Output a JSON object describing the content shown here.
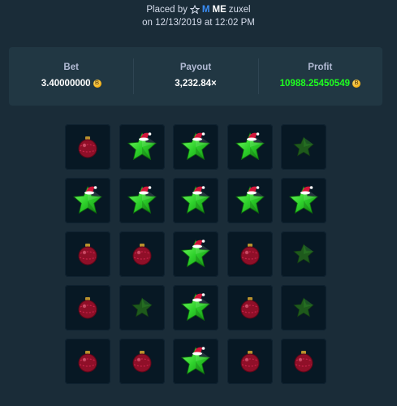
{
  "header": {
    "placed_by_label": "Placed by",
    "vip_badge": "M",
    "rank": "ME",
    "username": "zuxel",
    "date_line": "on 12/13/2019 at 12:02 PM"
  },
  "stats": {
    "bet_label": "Bet",
    "bet_value": "3.40000000",
    "payout_label": "Payout",
    "payout_value": "3,232.84×",
    "profit_label": "Profit",
    "profit_value": "10988.25450549"
  },
  "colors": {
    "background": "#1a2c38",
    "panel": "#213743",
    "tile": "#071824",
    "profit_green": "#1fff20",
    "star_green": "#2ed12b",
    "ornament_red": "#a0122e"
  },
  "icons": {
    "star_revealed": "star-gem-with-santa-hat-icon",
    "star_dim": "star-gem-icon",
    "ornament": "christmas-ornament-icon",
    "currency": "bitcoin-coin-icon"
  },
  "grid": {
    "rows": [
      [
        "ornament",
        "star_hat",
        "star_hat",
        "star_hat",
        "star_dim"
      ],
      [
        "star_hat",
        "star_hat",
        "star_hat",
        "star_hat",
        "star_hat"
      ],
      [
        "ornament",
        "ornament",
        "star_hat",
        "ornament",
        "star_dim"
      ],
      [
        "ornament",
        "star_dim",
        "star_hat",
        "ornament",
        "star_dim"
      ],
      [
        "ornament",
        "ornament",
        "star_hat",
        "ornament",
        "ornament"
      ]
    ]
  }
}
